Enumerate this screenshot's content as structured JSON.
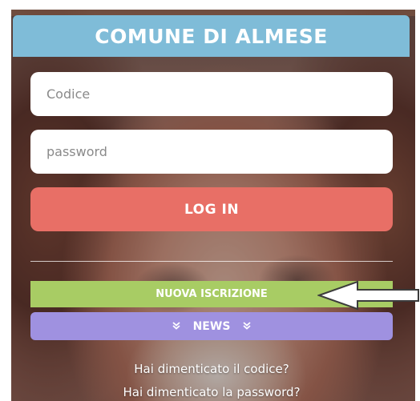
{
  "header": {
    "title": "COMUNE DI ALMESE",
    "color": "#7fbcd8"
  },
  "login_form": {
    "code_placeholder": "Codice",
    "code_value": "",
    "password_placeholder": "password",
    "password_value": "",
    "login_label": "LOG IN",
    "login_color": "#e86f66"
  },
  "actions": {
    "nuova_iscrizione_label": "NUOVA ISCRIZIONE",
    "nuova_iscrizione_color": "#a8cc64",
    "news_label": "NEWS",
    "news_icon": "double-chevron-down-icon",
    "news_color": "#9f91e0"
  },
  "annotation": {
    "icon": "left-arrow-outline-icon"
  },
  "links": {
    "forgot_code": "Hai dimenticato il codice?",
    "forgot_password": "Hai dimenticato la password?"
  }
}
